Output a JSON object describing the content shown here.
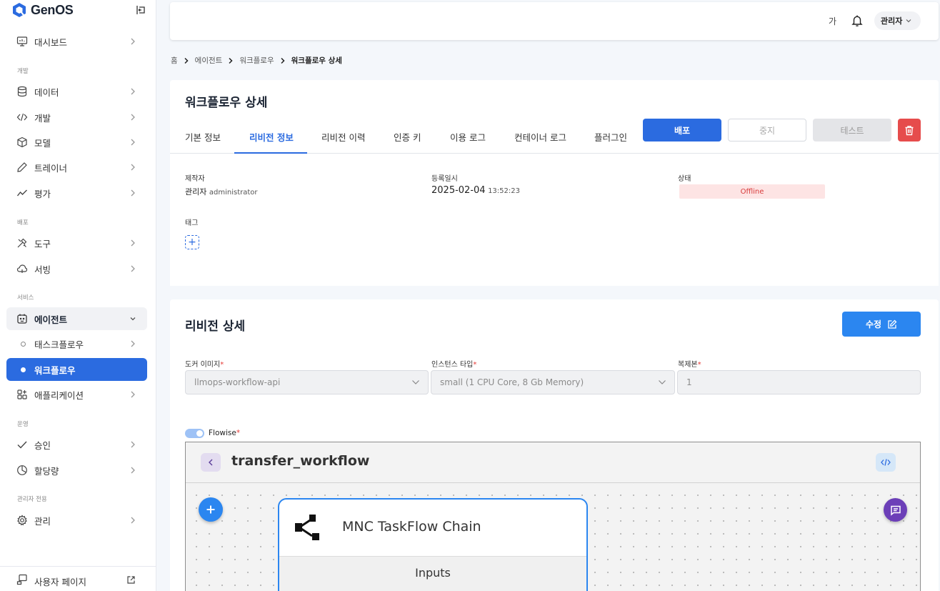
{
  "app": {
    "name": "GenOS"
  },
  "sidebar": {
    "items": {
      "dashboard": "대시보드",
      "data": "데이터",
      "dev": "개발",
      "model": "모델",
      "trainer": "트레이너",
      "eval": "평가",
      "tools": "도구",
      "serving": "서빙",
      "agent": "에이전트",
      "taskflow": "태스크플로우",
      "workflow": "워크플로우",
      "application": "애플리케이션",
      "approval": "승인",
      "quota": "할당량",
      "admin": "관리"
    },
    "sections": {
      "dev": "개발",
      "deploy": "배포",
      "service": "서비스",
      "ops": "운영",
      "admin_only": "관리자 전용"
    },
    "footer": {
      "user_page": "사용자 페이지"
    }
  },
  "header": {
    "font_size": "가",
    "user": "관리자"
  },
  "breadcrumb": [
    "홈",
    "에이전트",
    "워크플로우",
    "워크플로우 상세"
  ],
  "detail": {
    "title": "워크플로우 상세",
    "tabs": [
      "기본 정보",
      "리비전 정보",
      "리비전 이력",
      "인증 키",
      "이용 로그",
      "컨테이너 로그",
      "플러그인"
    ],
    "active_tab": "리비전 정보",
    "buttons": {
      "deploy": "배포",
      "stop": "중지",
      "test": "테스트"
    },
    "creator_label": "제작자",
    "creator_name": "관리자",
    "creator_id": "administrator",
    "created_label": "등록일시",
    "created_date": "2025-02-04",
    "created_time": "13:52:23",
    "status_label": "상태",
    "status": "Offline",
    "tag_label": "태그",
    "tag_add": "+"
  },
  "revision": {
    "title": "리비전 상세",
    "edit_label": "수정",
    "docker_label": "도커 이미지",
    "docker_value": "llmops-workflow-api",
    "instance_label": "인스턴스 타입",
    "instance_value": "small (1 CPU Core, 8 Gb Memory)",
    "replica_label": "복제본",
    "replica_value": "1",
    "required_mark": "*",
    "flowise_label": "Flowise",
    "flowise_enabled": true
  },
  "flowise": {
    "name": "transfer_workflow",
    "node_title": "MNC TaskFlow Chain",
    "node_section": "Inputs"
  },
  "colors": {
    "primary": "#2b6be0",
    "edit": "#2b86f0",
    "danger": "#e64c4c",
    "status_offline_bg": "#fde4e4",
    "status_offline_text": "#d83b3b",
    "chat_fab": "#6c3fb8"
  }
}
